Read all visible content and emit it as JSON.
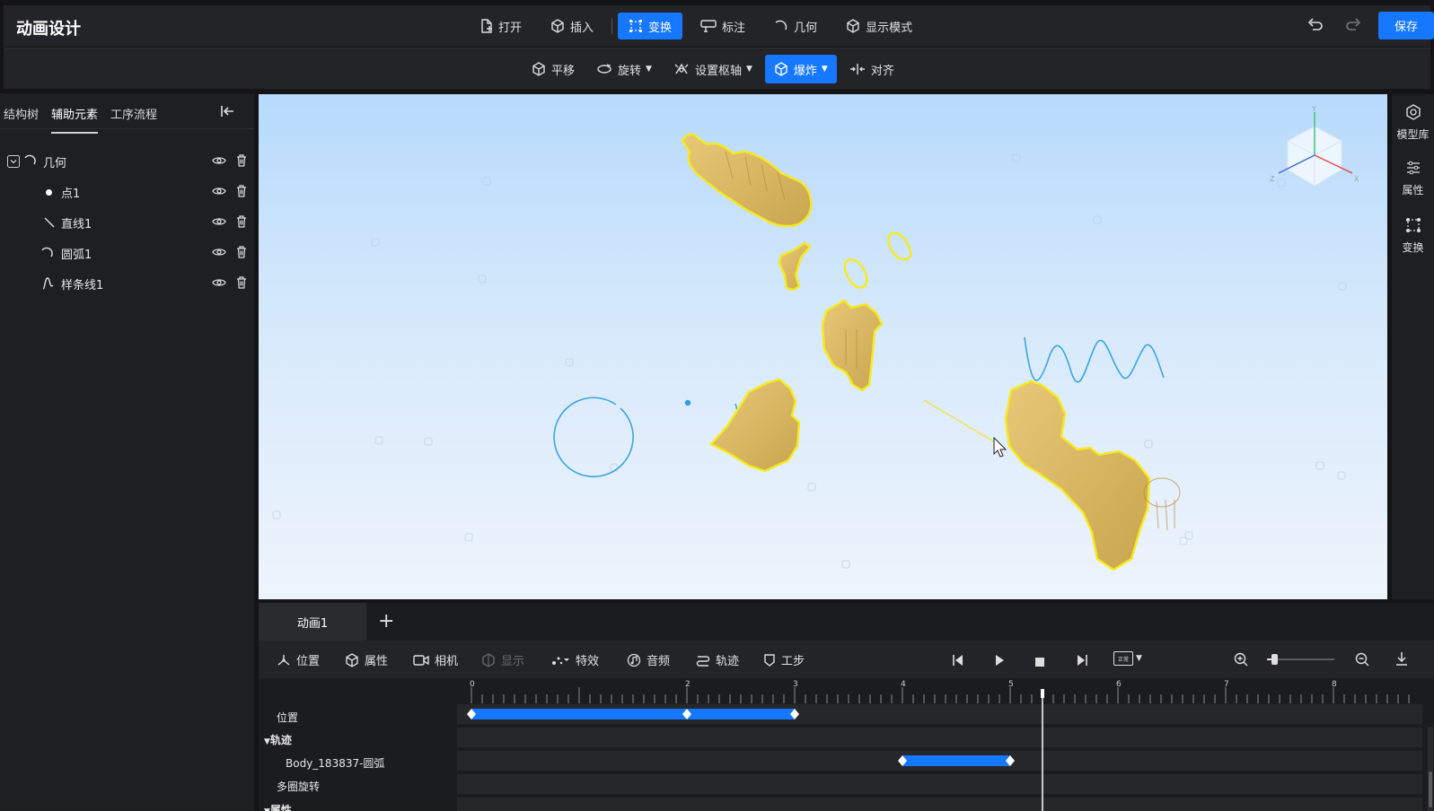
{
  "app": {
    "title": "动画设计"
  },
  "top_menu": {
    "items": [
      {
        "label": "打开",
        "icon": "file-open-icon"
      },
      {
        "label": "插入",
        "icon": "cube-insert-icon"
      },
      {
        "label": "变换",
        "icon": "transform-icon",
        "active": true
      },
      {
        "label": "标注",
        "icon": "annotation-icon"
      },
      {
        "label": "几何",
        "icon": "arc-icon"
      },
      {
        "label": "显示模式",
        "icon": "display-cube-icon"
      }
    ],
    "save_label": "保存"
  },
  "sub_menu": {
    "items": [
      {
        "label": "平移",
        "icon": "move-icon"
      },
      {
        "label": "旋转",
        "icon": "rotate-icon",
        "dropdown": true
      },
      {
        "label": "设置枢轴",
        "icon": "pivot-icon",
        "dropdown": true
      },
      {
        "label": "爆炸",
        "icon": "explode-icon",
        "dropdown": true,
        "active": true
      },
      {
        "label": "对齐",
        "icon": "align-icon"
      }
    ]
  },
  "left_panel": {
    "tabs": [
      "结构树",
      "辅助元素",
      "工序流程"
    ],
    "active_tab": 1,
    "tree": {
      "group_label": "几何",
      "children": [
        {
          "label": "点1",
          "icon": "point-icon"
        },
        {
          "label": "直线1",
          "icon": "line-icon"
        },
        {
          "label": "圆弧1",
          "icon": "arc-icon"
        },
        {
          "label": "样条线1",
          "icon": "spline-icon"
        }
      ]
    }
  },
  "right_rail": {
    "items": [
      {
        "label": "模型库",
        "icon": "model-library-icon"
      },
      {
        "label": "属性",
        "icon": "sliders-icon"
      },
      {
        "label": "变换",
        "icon": "transform-icon"
      }
    ]
  },
  "view_cube": {
    "axes": [
      "Y",
      "X",
      "Z"
    ]
  },
  "timeline": {
    "tab_label": "动画1",
    "add_label": "+",
    "toolbar": {
      "left": [
        {
          "label": "位置",
          "icon": "position-icon"
        },
        {
          "label": "属性",
          "icon": "cube-icon"
        },
        {
          "label": "相机",
          "icon": "camera-icon"
        },
        {
          "label": "显示",
          "icon": "display-icon",
          "disabled": true
        },
        {
          "label": "特效",
          "icon": "effects-icon"
        },
        {
          "label": "音频",
          "icon": "audio-icon"
        },
        {
          "label": "轨迹",
          "icon": "track-icon"
        },
        {
          "label": "工步",
          "icon": "step-icon"
        }
      ],
      "speed_badge": "正常"
    },
    "ruler_labels": [
      "0",
      "2",
      "3",
      "4",
      "5",
      "6",
      "7",
      "8"
    ],
    "tracks": [
      {
        "label": "位置",
        "keyframes": [
          0,
          2,
          3
        ]
      },
      {
        "label": "轨迹",
        "group": true
      },
      {
        "label": "Body_183837-圆弧",
        "keyframes": [
          4,
          5
        ]
      },
      {
        "label": "多圈旋转"
      },
      {
        "label": "属性",
        "group": true
      }
    ],
    "playhead": 5.3
  }
}
